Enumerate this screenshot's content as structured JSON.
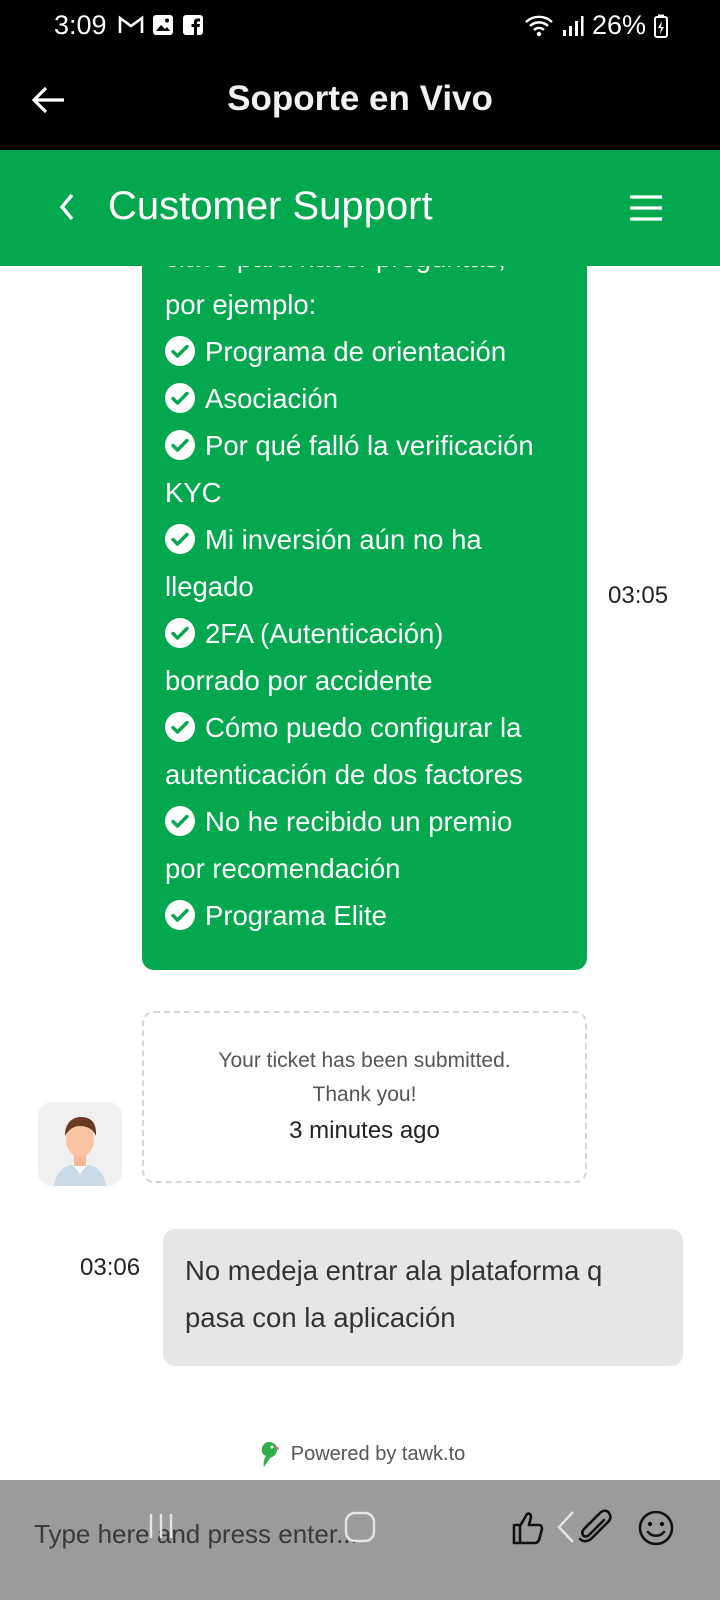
{
  "status_bar": {
    "time": "3:09",
    "battery": "26%",
    "left_icons": [
      "gmail-icon",
      "gallery-icon",
      "facebook-icon"
    ],
    "right_icons": [
      "wifi-icon",
      "signal-icon",
      "battery-charging-icon"
    ]
  },
  "app_bar": {
    "title": "Soporte en Vivo"
  },
  "chat_header": {
    "title": "Customer Support",
    "color": "#03a84e"
  },
  "agent_message": {
    "partial_first_line": "clave para hacer preguntas,",
    "intro": "por ejemplo:",
    "items": [
      {
        "line1": "Programa de orientación",
        "line2": ""
      },
      {
        "line1": "Asociación",
        "line2": ""
      },
      {
        "line1": "Por qué falló la verificación",
        "line2": "KYC"
      },
      {
        "line1": "Mi inversión aún no ha",
        "line2": "llegado"
      },
      {
        "line1": "2FA (Autenticación)",
        "line2": "borrado por accidente"
      },
      {
        "line1": "Cómo puedo configurar la",
        "line2": "autenticación de dos factores"
      },
      {
        "line1": "No he recibido un premio",
        "line2": "por recomendación"
      },
      {
        "line1": "Programa Elite",
        "line2": ""
      }
    ],
    "time": "03:05"
  },
  "ticket": {
    "line1": "Your ticket has been submitted.",
    "line2": "Thank you!",
    "time": "3 minutes ago"
  },
  "user_message": {
    "line1": "No medeja entrar ala plataforma q",
    "line2": "pasa con la aplicación",
    "time": "03:06"
  },
  "footer": {
    "powered_by": "Powered by tawk.to"
  },
  "input": {
    "placeholder": "Type here and press enter..."
  }
}
